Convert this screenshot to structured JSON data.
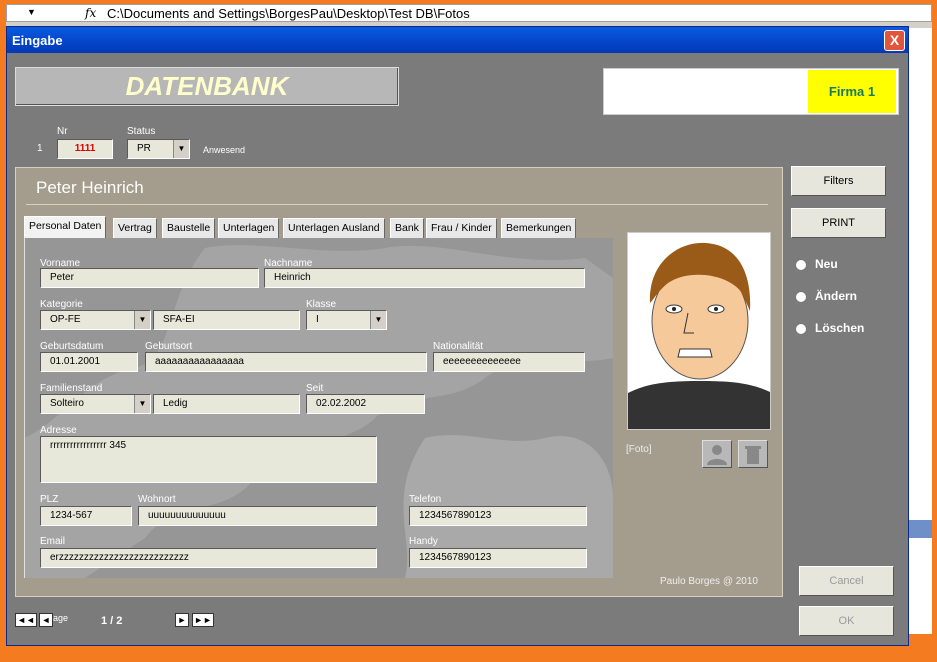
{
  "formula_bar": {
    "fx": "fx",
    "path": "C:\\Documents and Settings\\BorgesPau\\Desktop\\Test DB\\Fotos"
  },
  "window": {
    "title": "Eingabe",
    "close": "X"
  },
  "header": {
    "title": "DATENBANK",
    "firma": "Firma 1"
  },
  "record": {
    "row_index": "1",
    "nr_label": "Nr",
    "nr_value": "1111",
    "status_label": "Status",
    "status_value": "PR",
    "status_text": "Anwesend"
  },
  "employee_name": "Peter Heinrich",
  "tabs": [
    "Personal Daten",
    "Vertrag",
    "Baustelle",
    "Unterlagen",
    "Unterlagen Ausland",
    "Bank",
    "Frau / Kinder",
    "Bemerkungen"
  ],
  "form": {
    "vorname": {
      "label": "Vorname",
      "value": "Peter"
    },
    "nachname": {
      "label": "Nachname",
      "value": "Heinrich"
    },
    "kategorie": {
      "label": "Kategorie",
      "value": "OP-FE",
      "extra": "SFA-EI"
    },
    "klasse": {
      "label": "Klasse",
      "value": "I"
    },
    "geburtsdatum": {
      "label": "Geburtsdatum",
      "value": "01.01.2001"
    },
    "geburtsort": {
      "label": "Geburtsort",
      "value": "aaaaaaaaaaaaaaaa"
    },
    "nationalitaet": {
      "label": "Nationalität",
      "value": "eeeeeeeeeeeeee"
    },
    "familienstand": {
      "label": "Familienstand",
      "value": "Solteiro",
      "extra": "Ledig"
    },
    "seit": {
      "label": "Seit",
      "value": "02.02.2002"
    },
    "adresse": {
      "label": "Adresse",
      "value": "rrrrrrrrrrrrrrrrr 345"
    },
    "plz": {
      "label": "PLZ",
      "value": "1234-567"
    },
    "wohnort": {
      "label": "Wohnort",
      "value": "uuuuuuuuuuuuuu"
    },
    "telefon": {
      "label": "Telefon",
      "value": "1234567890123"
    },
    "email": {
      "label": "Email",
      "value": "erzzzzzzzzzzzzzzzzzzzzzzzzzz"
    },
    "handy": {
      "label": "Handy",
      "value": "1234567890123"
    }
  },
  "photo_label": "[Foto]",
  "credit": "Paulo Borges @ 2010",
  "buttons": {
    "filters": "Filters",
    "print": "PRINT",
    "cancel": "Cancel",
    "ok": "OK"
  },
  "options": [
    "Neu",
    "Ändern",
    "Löschen"
  ],
  "nav": {
    "first": "◄◄",
    "prev": "◄",
    "next": "►",
    "last": "►►",
    "page_label": "age",
    "page": "1 / 2"
  },
  "icons": [
    "formula-dropdown-icon",
    "close-icon",
    "combo-arrow-icon",
    "add-photo-icon",
    "delete-photo-icon"
  ]
}
